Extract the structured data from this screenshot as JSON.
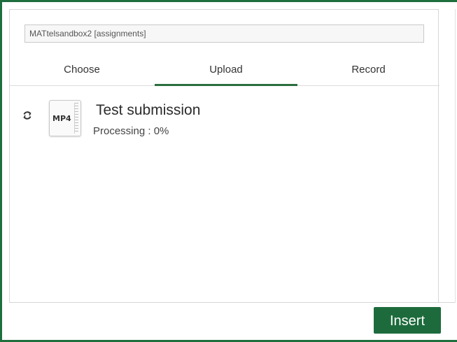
{
  "source": {
    "value": "MATtelsandbox2 [assignments]"
  },
  "tabs": [
    {
      "label": "Choose"
    },
    {
      "label": "Upload",
      "active": true
    },
    {
      "label": "Record"
    }
  ],
  "upload_item": {
    "file_type": "MP4",
    "title": "Test submission",
    "status": "Processing : 0%",
    "progress_percent": 0
  },
  "footer": {
    "insert_label": "Insert"
  },
  "colors": {
    "accent": "#1d6b3c",
    "frame": "#1e6e3e"
  }
}
